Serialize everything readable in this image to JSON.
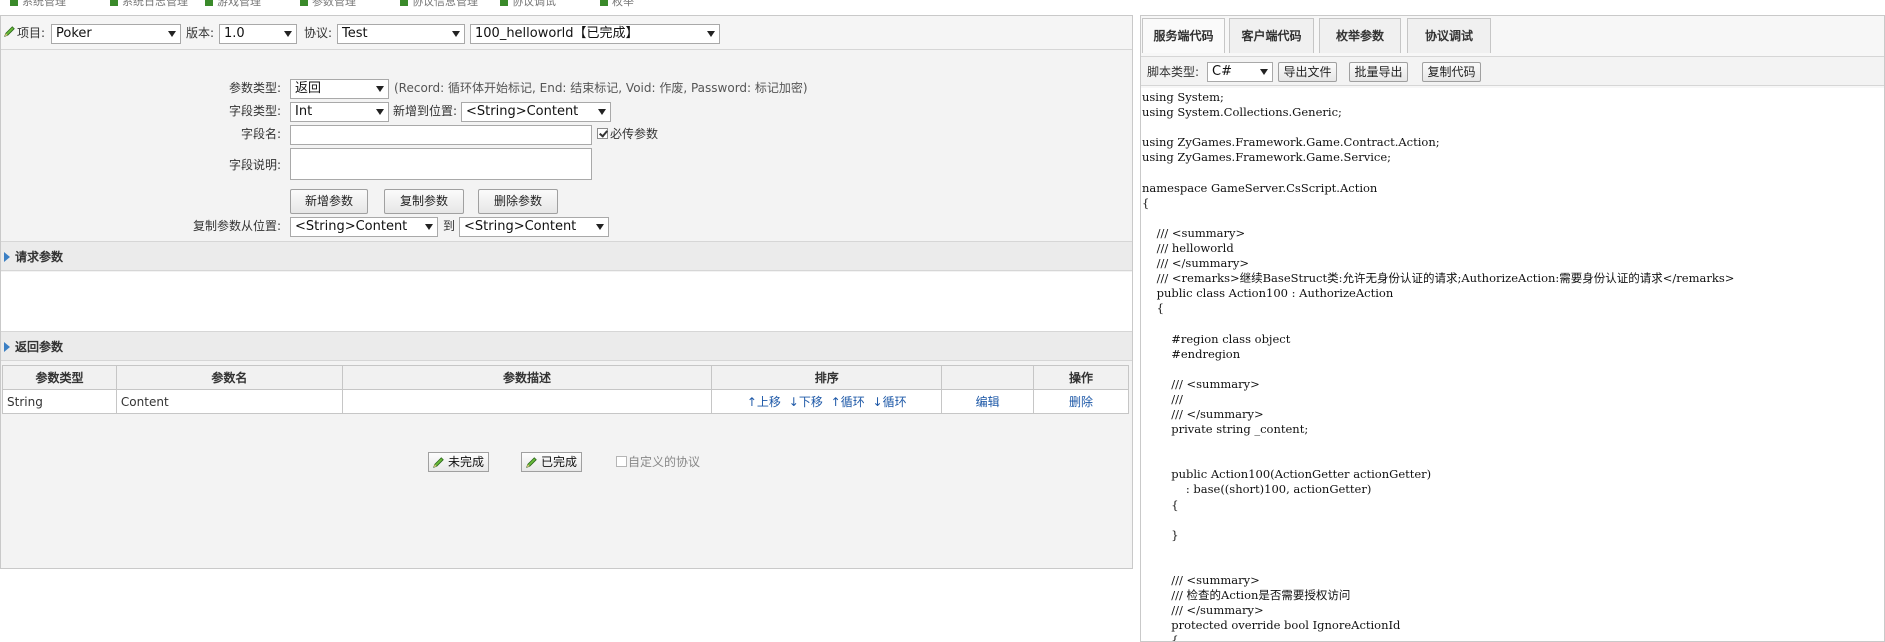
{
  "top_strip": [
    "系统管理",
    "系统日志管理",
    "游戏管理",
    "参数管理",
    "协议信息管理",
    "协议调试",
    "枚举"
  ],
  "toolbar": {
    "project_label": "项目:",
    "project_value": "Poker",
    "version_label": "版本:",
    "version_value": "1.0",
    "protocol_label": "协议:",
    "protocol_value": "Test",
    "action_value": "100_helloworld【已完成】"
  },
  "form": {
    "param_type_label": "参数类型:",
    "param_type_value": "返回",
    "param_type_hint": "(Record: 循环体开始标记, End: 结束标记, Void: 作废, Password: 标记加密)",
    "field_type_label": "字段类型:",
    "field_type_value": "Int",
    "add_position_label": "新增到位置:",
    "add_position_value": "<String>Content",
    "field_name_label": "字段名:",
    "required_label": "必传参数",
    "field_desc_label": "字段说明:",
    "add_button": "新增参数",
    "copy_button": "复制参数",
    "delete_button": "删除参数",
    "copy_from_label": "复制参数从位置:",
    "copy_from_value": "<String>Content",
    "copy_to_label": "到",
    "copy_to_value": "<String>Content"
  },
  "request_section": {
    "title": "请求参数"
  },
  "return_section": {
    "title": "返回参数",
    "columns": [
      "参数类型",
      "参数名",
      "参数描述",
      "排序",
      "",
      "操作"
    ],
    "rows": [
      {
        "type": "String",
        "name": "Content",
        "desc": "",
        "up": "↑上移",
        "down": "↓下移",
        "loop_up": "↑循环",
        "loop_down": "↓循环",
        "edit": "编辑",
        "delete": "删除"
      }
    ]
  },
  "status": {
    "incomplete": "未完成",
    "complete": "已完成",
    "custom_label": "自定义的协议"
  },
  "right": {
    "tabs": [
      "服务端代码",
      "客户端代码",
      "枚举参数",
      "协议调试"
    ],
    "script_type_label": "脚本类型:",
    "script_type_value": "C#",
    "export_button": "导出文件",
    "batch_export_button": "批量导出",
    "copy_code_button": "复制代码",
    "code": "using System;\nusing System.Collections.Generic;\n\nusing ZyGames.Framework.Game.Contract.Action;\nusing ZyGames.Framework.Game.Service;\n\nnamespace GameServer.CsScript.Action\n{\n\n    /// <summary>\n    /// helloworld\n    /// </summary>\n    /// <remarks>继续BaseStruct类:允许无身份认证的请求;AuthorizeAction:需要身份认证的请求</remarks>\n    public class Action100 : AuthorizeAction\n    {\n\n        #region class object\n        #endregion\n\n        /// <summary>\n        ///\n        /// </summary>\n        private string _content;\n\n\n        public Action100(ActionGetter actionGetter)\n            : base((short)100, actionGetter)\n        {\n\n        }\n\n\n        /// <summary>\n        /// 检查的Action是否需要授权访问\n        /// </summary>\n        protected override bool IgnoreActionId\n        {"
  },
  "colors": {
    "accent": "#3b7fc4",
    "link": "#1d58a7",
    "pencil": "#3a8a2a"
  }
}
